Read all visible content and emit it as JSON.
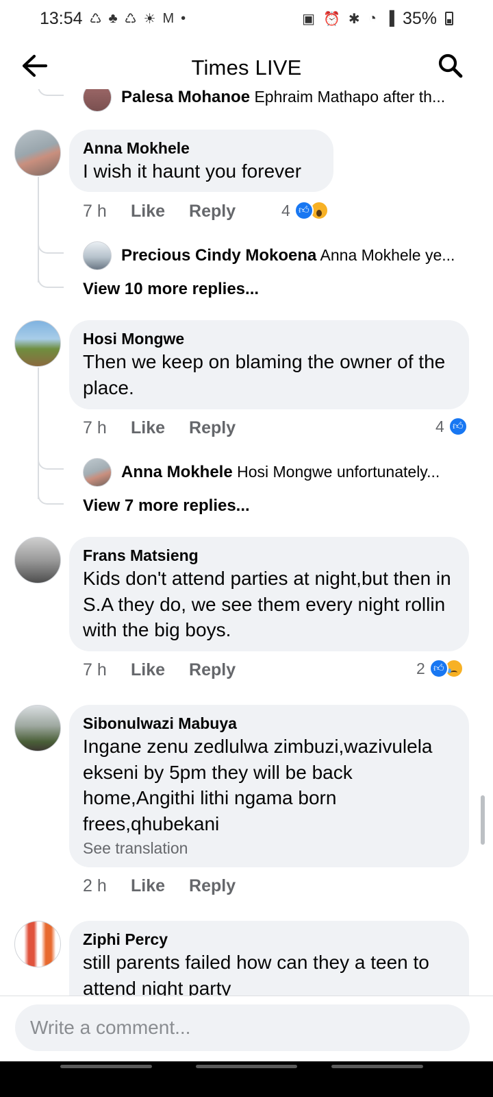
{
  "status_bar": {
    "time": "13:54",
    "battery": "35%",
    "left_icons": [
      "sync-icon",
      "notification-icon",
      "sync-icon",
      "weather-icon",
      "gmail-icon",
      "dot-icon"
    ],
    "right_icons": [
      "lock-icon",
      "alarm-icon",
      "bluetooth-icon",
      "wifi-icon",
      "signal-icon",
      "battery-icon"
    ]
  },
  "header": {
    "title": "Times LIVE"
  },
  "top_partial": {
    "author": "Palesa Mohanoe",
    "text": "Ephraim Mathapo after th..."
  },
  "comments": [
    {
      "author": "Anna Mokhele",
      "text": "I wish it haunt you forever",
      "time": "7 h",
      "like": "Like",
      "reply": "Reply",
      "reaction_count": "4",
      "reactions": [
        "like",
        "wow"
      ],
      "latest_reply": {
        "author": "Precious Cindy Mokoena",
        "text": "Anna Mokhele ye..."
      },
      "view_more": "View 10 more replies..."
    },
    {
      "author": "Hosi Mongwe",
      "text": "Then we keep on blaming the owner of the place.",
      "time": "7 h",
      "like": "Like",
      "reply": "Reply",
      "reaction_count": "4",
      "reactions": [
        "like"
      ],
      "latest_reply": {
        "author": "Anna Mokhele",
        "text": "Hosi Mongwe unfortunately..."
      },
      "view_more": "View 7 more replies..."
    },
    {
      "author": "Frans Matsieng",
      "text": "Kids don't attend parties at night,but then in S.A they do, we see them every night rollin with the big boys.",
      "time": "7 h",
      "like": "Like",
      "reply": "Reply",
      "reaction_count": "2",
      "reactions": [
        "like",
        "sad"
      ]
    },
    {
      "author": "Sibonulwazi Mabuya",
      "text": "Ingane zenu zedlulwa zimbuzi,wazivulela ekseni by 5pm they will be back home,Angithi lithi ngama born frees,qhubekani",
      "see_translation": "See translation",
      "time": "2 h",
      "like": "Like",
      "reply": "Reply"
    },
    {
      "author": "Ziphi Percy",
      "text": "still parents failed how can they a teen to attend night party"
    }
  ],
  "composer": {
    "placeholder": "Write a comment..."
  },
  "colors": {
    "bubble": "#f0f2f5",
    "like_blue": "#1877f2",
    "meta_gray": "#65676b",
    "reaction_yellow": "#f7b125"
  }
}
